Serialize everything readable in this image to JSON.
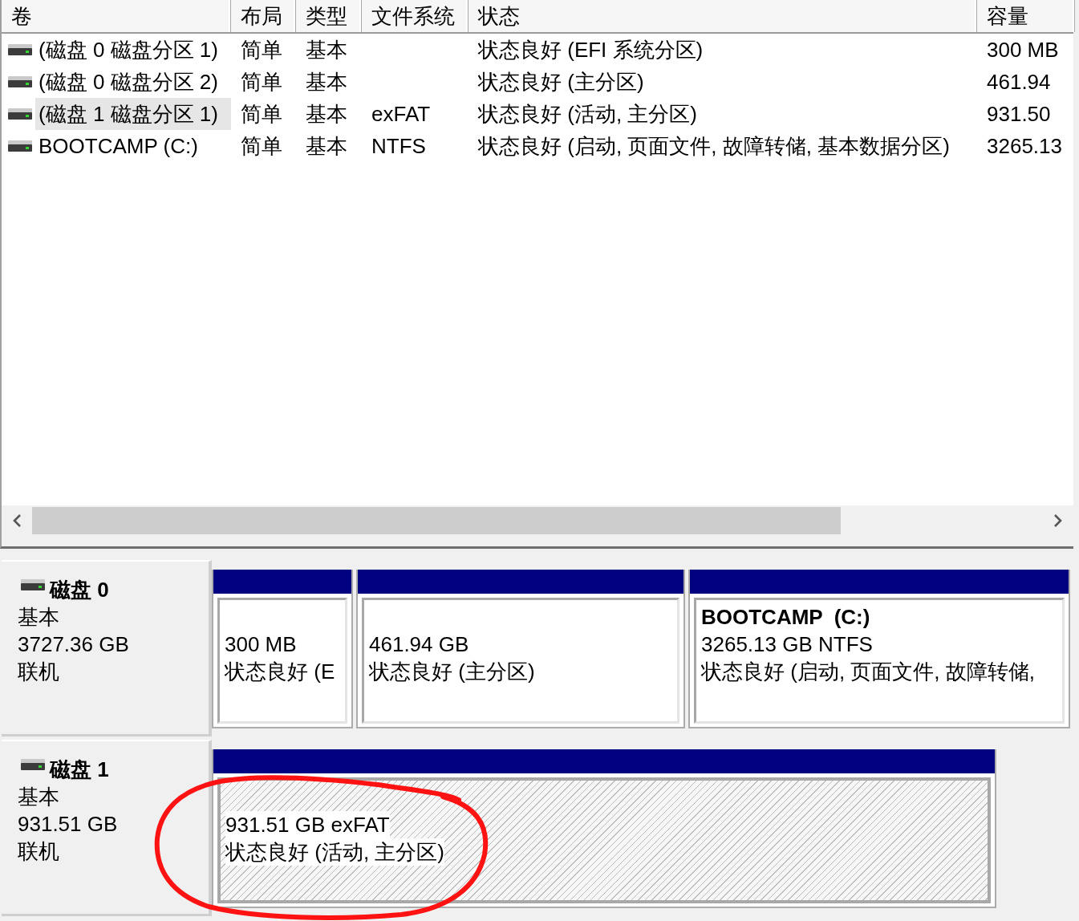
{
  "volume_table": {
    "columns": [
      "卷",
      "布局",
      "类型",
      "文件系统",
      "状态",
      "容量"
    ],
    "rows": [
      {
        "volume": "(磁盘 0 磁盘分区 1)",
        "layout": "简单",
        "type": "基本",
        "status": "状态良好 (EFI 系统分区)",
        "capacity": "300 MB",
        "selected": false
      },
      {
        "volume": "(磁盘 0 磁盘分区 2)",
        "layout": "简单",
        "type": "基本",
        "status": "状态良好 (主分区)",
        "capacity": "461.94",
        "selected": false
      },
      {
        "volume": "(磁盘 1 磁盘分区 1)",
        "layout": "简单",
        "type": "基本",
        "file_system": "exFAT",
        "status": "状态良好 (活动, 主分区)",
        "capacity": "931.50",
        "selected": true
      },
      {
        "volume": "BOOTCAMP (C:)",
        "layout": "简单",
        "type": "基本",
        "file_system": "NTFS",
        "status": "状态良好 (启动, 页面文件, 故障转储, 基本数据分区)",
        "capacity": "3265.13",
        "selected": false
      }
    ]
  },
  "disks": [
    {
      "name": "磁盘 0",
      "type": "基本",
      "capacity": "3727.36 GB",
      "status": "联机",
      "partitions": [
        {
          "lines": [
            "300 MB",
            "状态良好 (E"
          ],
          "selected": false,
          "circled": false
        },
        {
          "lines": [
            "461.94 GB",
            "状态良好 (主分区)"
          ],
          "selected": false,
          "circled": false
        },
        {
          "title": "BOOTCAMP  (C:)",
          "lines": [
            "3265.13 GB NTFS",
            "状态良好 (启动, 页面文件, 故障转储,"
          ],
          "selected": false,
          "circled": false
        }
      ]
    },
    {
      "name": "磁盘 1",
      "type": "基本",
      "capacity": "931.51 GB",
      "status": "联机",
      "partitions": [
        {
          "lines": [
            "931.51 GB exFAT",
            "状态良好 (活动, 主分区)"
          ],
          "selected": true,
          "circled": true
        }
      ]
    }
  ]
}
